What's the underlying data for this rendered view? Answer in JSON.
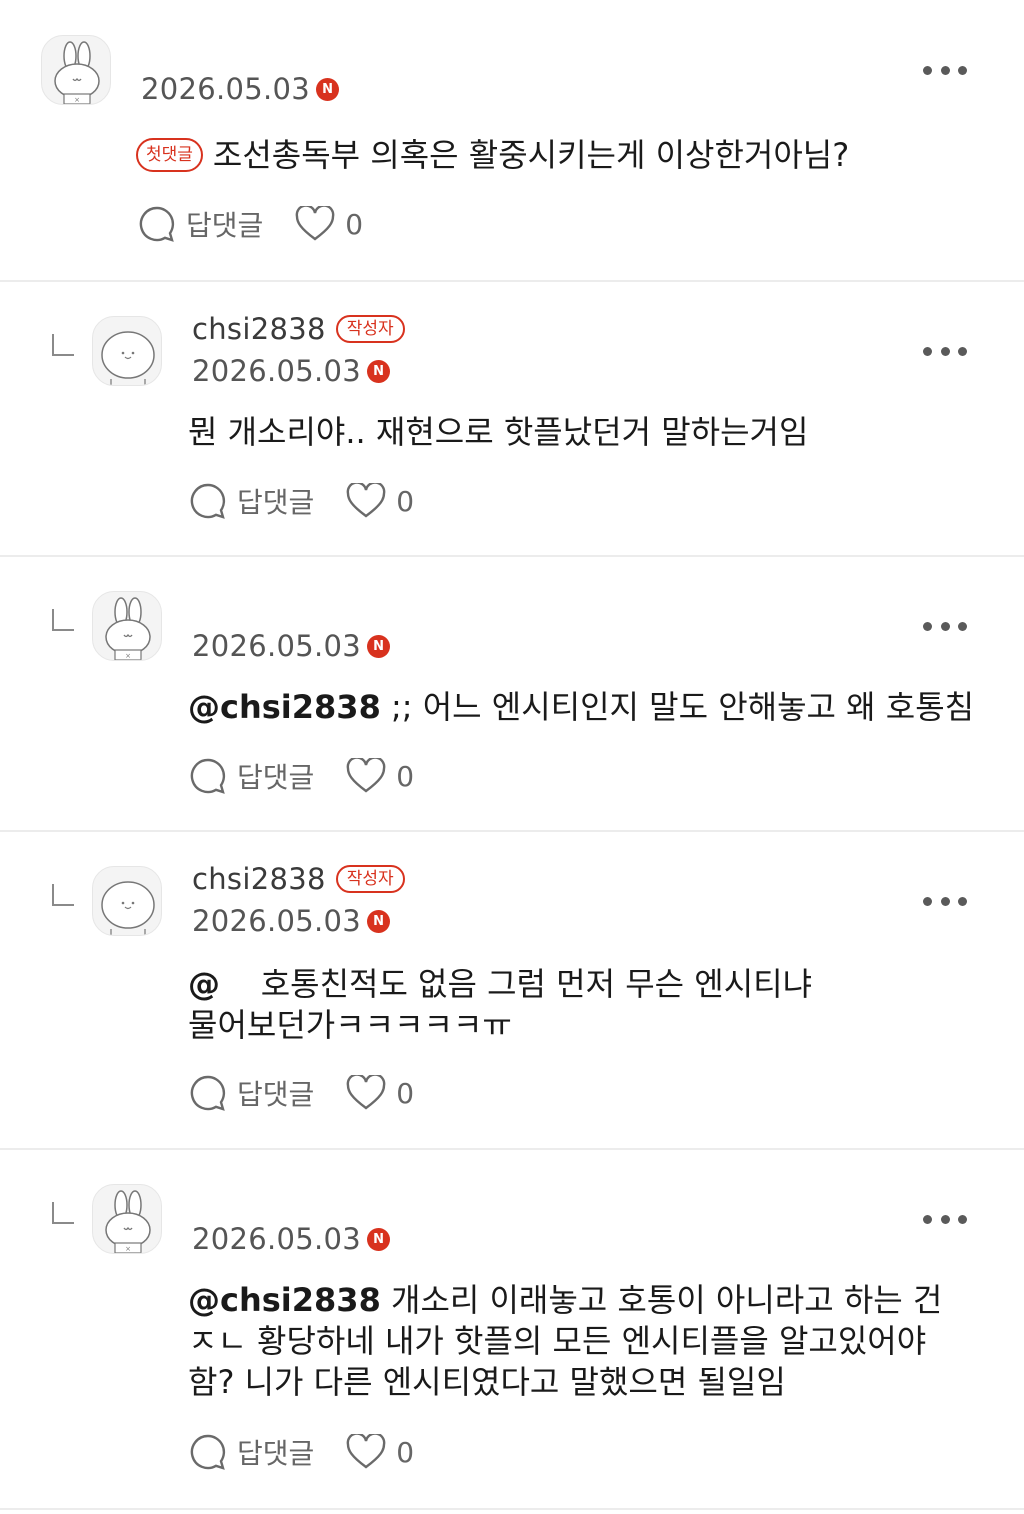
{
  "colors": {
    "accent": "#d8321e",
    "divider": "#ececec",
    "text": "#1a1a1a",
    "meta": "#555555"
  },
  "labels": {
    "reply": "답댓글",
    "author_badge": "작성자",
    "first_badge": "첫댓글",
    "n_mark": "N"
  },
  "comments": [
    {
      "avatar": "bunny-avatar",
      "author": "",
      "date": "2026.05.03",
      "first": true,
      "mention": "",
      "text": "조선총독부 의혹은 활중시키는게 이상한거아님?",
      "likes": "0"
    },
    {
      "avatar": "round-face-avatar",
      "author": "chsi2838",
      "is_author": true,
      "date": "2026.05.03",
      "mention": "",
      "text": "뭔 개소리야.. 재현으로 핫플났던거 말하는거임",
      "likes": "0"
    },
    {
      "avatar": "bunny-avatar",
      "author": "",
      "date": "2026.05.03",
      "mention": "@chsi2838",
      "text": " ;; 어느 엔시티인지 말도 안해놓고 왜 호통침",
      "likes": "0"
    },
    {
      "avatar": "round-face-avatar",
      "author": "chsi2838",
      "is_author": true,
      "date": "2026.05.03",
      "mention": "@",
      "text": "    호통친적도 없음 그럼 먼저 무슨 엔시티냐 물어보던가ㅋㅋㅋㅋㅋㅠ",
      "likes": "0"
    },
    {
      "avatar": "bunny-avatar",
      "author": "",
      "date": "2026.05.03",
      "mention": "@chsi2838",
      "text": " 개소리 이래놓고 호통이 아니라고 하는 건 ㅈㄴ 황당하네 내가 핫플의 모든 엔시티플을 알고있어야함? 니가 다른 엔시티였다고 말했으면 될일임",
      "likes": "0"
    }
  ]
}
